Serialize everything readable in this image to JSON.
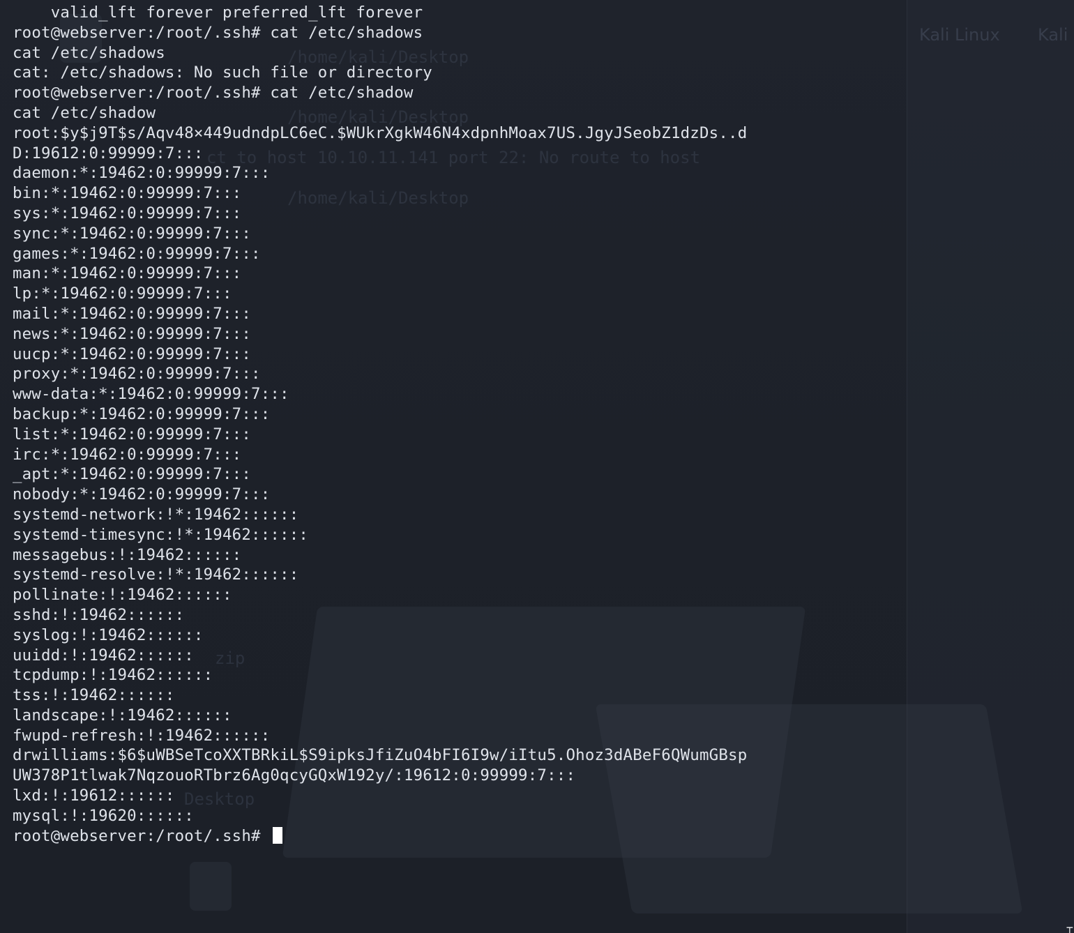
{
  "terminal": {
    "lines": [
      "    valid_lft forever preferred_lft forever",
      "root@webserver:/root/.ssh# cat /etc/shadows",
      "cat /etc/shadows",
      "cat: /etc/shadows: No such file or directory",
      "root@webserver:/root/.ssh# cat /etc/shadow",
      "cat /etc/shadow",
      "root:$y$j9T$s/Aqv48×449udndpLC6eC.$WUkrXgkW46N4xdpnhMoax7US.JgyJSeobZ1dzDs..d",
      "D:19612:0:99999:7:::",
      "daemon:*:19462:0:99999:7:::",
      "bin:*:19462:0:99999:7:::",
      "sys:*:19462:0:99999:7:::",
      "sync:*:19462:0:99999:7:::",
      "games:*:19462:0:99999:7:::",
      "man:*:19462:0:99999:7:::",
      "lp:*:19462:0:99999:7:::",
      "mail:*:19462:0:99999:7:::",
      "news:*:19462:0:99999:7:::",
      "uucp:*:19462:0:99999:7:::",
      "proxy:*:19462:0:99999:7:::",
      "www-data:*:19462:0:99999:7:::",
      "backup:*:19462:0:99999:7:::",
      "list:*:19462:0:99999:7:::",
      "irc:*:19462:0:99999:7:::",
      "_apt:*:19462:0:99999:7:::",
      "nobody:*:19462:0:99999:7:::",
      "systemd-network:!*:19462::::::",
      "systemd-timesync:!*:19462::::::",
      "messagebus:!:19462::::::",
      "systemd-resolve:!*:19462::::::",
      "pollinate:!:19462::::::",
      "sshd:!:19462::::::",
      "syslog:!:19462::::::",
      "uuidd:!:19462::::::",
      "tcpdump:!:19462::::::",
      "tss:!:19462::::::",
      "landscape:!:19462::::::",
      "fwupd-refresh:!:19462::::::",
      "drwilliams:$6$uWBSeTcoXXTBRkiL$S9ipksJfiZuO4bFI6I9w/iItu5.Ohoz3dABeF6QWumGBsp",
      "UW378P1tlwak7NqzouoRTbrz6Ag0qcyGQxW192y/:19612:0:99999:7:::",
      "lxd:!:19612::::::",
      "mysql:!:19620::::::"
    ],
    "prompt": "root@webserver:/root/.ssh# "
  },
  "background": {
    "ghost_text": [
      "/home/kali/Desktop",
      "/home/kali/Desktop",
      "ct to host 10.10.11.141 port 22: No route to host",
      "/home/kali/Desktop",
      "zip",
      "Desktop"
    ],
    "taskbar_labels": [
      "Kali Linux",
      "Kali"
    ]
  },
  "colors": {
    "background": "#1e222b",
    "text": "#dfe3ea",
    "cursor": "#ffffff"
  }
}
